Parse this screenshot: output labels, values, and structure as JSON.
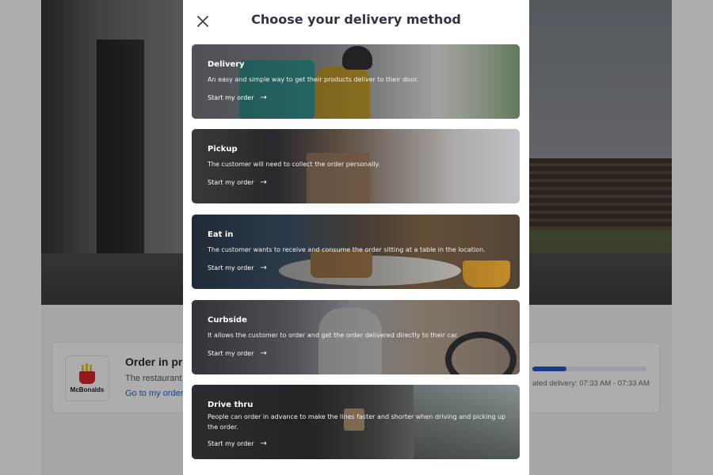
{
  "background": {
    "status_card": {
      "logo_text": "McBonalds",
      "title": "Order in pro",
      "subtitle": "The restaurant",
      "link": "Go to my order",
      "progress": 0.3,
      "estimate": "ated delivery: 07:33 AM - 07:33 AM"
    }
  },
  "modal": {
    "title": "Choose your delivery method",
    "close_icon": "close-icon",
    "options": [
      {
        "id": "delivery",
        "title": "Delivery",
        "description": "An easy and simple way to get their products deliver to their door.",
        "cta": "Start my order",
        "arrow": "→"
      },
      {
        "id": "pickup",
        "title": "Pickup",
        "description": "The customer will need to collect the order personally.",
        "cta": "Start my order",
        "arrow": "→"
      },
      {
        "id": "eat-in",
        "title": "Eat in",
        "description": "The customer wants to receive and consume the order sitting at a table in the location.",
        "cta": "Start my order",
        "arrow": "→"
      },
      {
        "id": "curbside",
        "title": "Curbside",
        "description": "It allows the customer to order and get the order delivered directly to their car.",
        "cta": "Start my order",
        "arrow": "→"
      },
      {
        "id": "drive-thru",
        "title": "Drive thru",
        "description": "People can order in advance to make the lines faster and shorter when driving and picking up the order.",
        "cta": "Start my order",
        "arrow": "→"
      }
    ]
  },
  "colors": {
    "modal_title": "#2f3344",
    "link": "#2b63c8",
    "progress": "#2558c9",
    "overlay": "rgba(0,0,0,0.32)"
  }
}
